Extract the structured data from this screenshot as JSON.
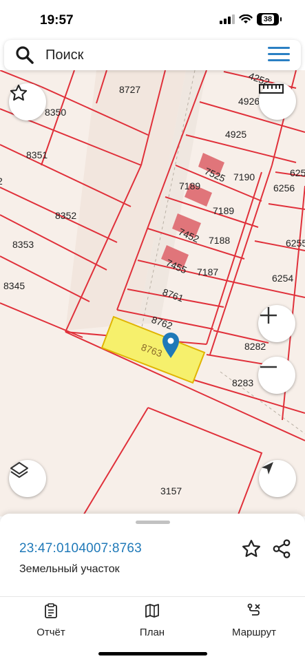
{
  "status": {
    "time": "19:57",
    "battery": "38"
  },
  "search": {
    "placeholder": "Поиск"
  },
  "map": {
    "parcel_labels": [
      "8727",
      "8350",
      "8351",
      "8352",
      "8353",
      "8345",
      "4926",
      "4925",
      "7525",
      "7190",
      "7189",
      "7189",
      "7452",
      "7188",
      "7455",
      "7187",
      "8761",
      "8762",
      "8763",
      "6255",
      "6256",
      "6255",
      "6254",
      "8282",
      "8283",
      "3157",
      "2",
      "4252"
    ],
    "selected_parcel": "8763",
    "colors": {
      "boundary": "#e0303a",
      "selected_fill": "#f6f06c",
      "building": "#e0757a",
      "background": "#f7efe9",
      "accent": "#1f79b8"
    }
  },
  "sheet": {
    "cadastral_number": "23:47:0104007:8763",
    "plot_type": "Земельный участок"
  },
  "tabbar": {
    "items": [
      {
        "label": "Отчёт",
        "icon": "report-icon"
      },
      {
        "label": "План",
        "icon": "map-plan-icon"
      },
      {
        "label": "Маршрут",
        "icon": "route-icon"
      }
    ]
  }
}
